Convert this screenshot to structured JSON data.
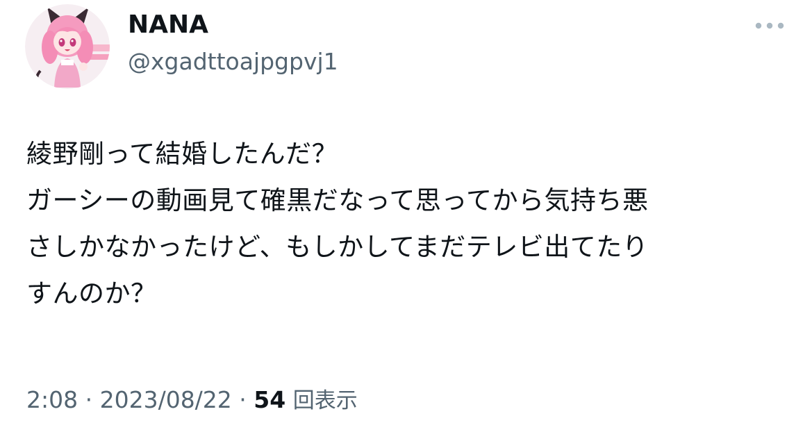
{
  "author": {
    "display_name": "NANA",
    "handle": "@xgadttoajpgpvj1"
  },
  "tweet": {
    "text": "綾野剛って結婚したんだ？\nガーシーの動画見て確黒だなって思ってから気持ち悪\nさしかなかったけど、もしかしてまだテレビ出てたり\nすんのか？"
  },
  "meta": {
    "time": "2:08",
    "separator": " · ",
    "date": "2023/08/22",
    "views_count": "54",
    "views_label": "回表示"
  },
  "colors": {
    "text_primary": "#0f1419",
    "text_secondary": "#536471",
    "avatar_accent": "#ff7aa8"
  },
  "icons": {
    "more": "more-dots-icon",
    "avatar": "anime-girl-avatar"
  }
}
